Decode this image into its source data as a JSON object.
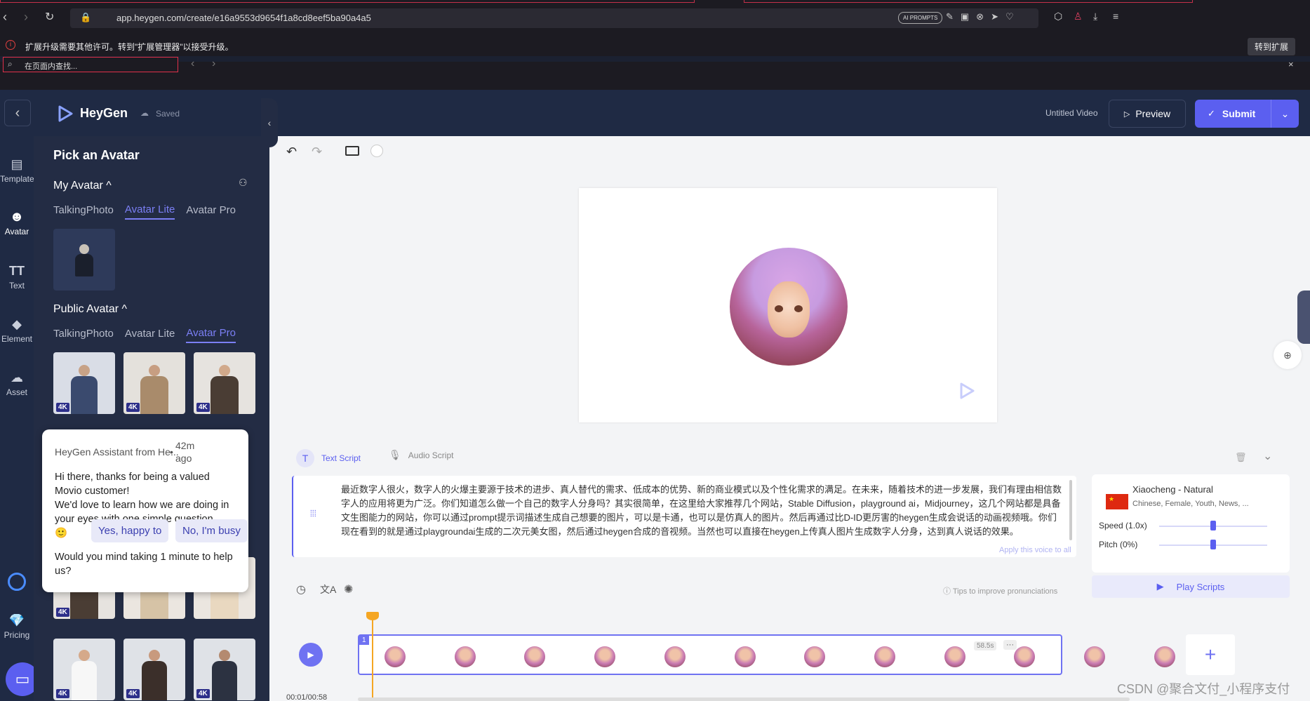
{
  "browser": {
    "url": "app.heygen.com/create/e16a9553d9654f1a8cd8eef5ba90a4a5",
    "ai_prompts": "AI PROMPTS",
    "ext_notice": "扩展升级需要其他许可。转到\"扩展管理器\"以接受升级。",
    "ext_button": "转到扩展",
    "find_placeholder": "在页面内查找...",
    "close": "×"
  },
  "header": {
    "brand": "HeyGen",
    "saved": "Saved",
    "video_title": "Untitled Video",
    "preview": "Preview",
    "submit": "Submit"
  },
  "sidebar": {
    "items": [
      {
        "label": "Template",
        "icon": "template-icon"
      },
      {
        "label": "Avatar",
        "icon": "avatar-icon"
      },
      {
        "label": "Text",
        "icon": "text-icon"
      },
      {
        "label": "Element",
        "icon": "element-icon"
      },
      {
        "label": "Asset",
        "icon": "asset-icon"
      },
      {
        "label": "Pricing",
        "icon": "pricing-icon"
      }
    ]
  },
  "panel": {
    "title": "Pick an Avatar",
    "my_avatar": "My Avatar",
    "public_avatar": "Public Avatar",
    "my_tabs": [
      "TalkingPhoto",
      "Avatar Lite",
      "Avatar Pro"
    ],
    "public_tabs": [
      "TalkingPhoto",
      "Avatar Lite",
      "Avatar Pro"
    ],
    "badge": "4K"
  },
  "chat": {
    "sender": "HeyGen Assistant from He...",
    "time": "42m ago",
    "sep": "•",
    "line1": "Hi there, thanks for being a valued Movio customer!",
    "line2": "We'd love to learn how we are doing in your eyes with one simple question",
    "emoji": "🙂",
    "line3": "Would you mind taking 1 minute to help us?",
    "yes": "Yes, happy to",
    "no": "No, I'm busy"
  },
  "script": {
    "tab_text": "Text Script",
    "tab_audio": "Audio Script",
    "body": "最近数字人很火，数字人的火爆主要源于技术的进步、真人替代的需求、低成本的优势、新的商业模式以及个性化需求的满足。在未来，随着技术的进一步发展，我们有理由相信数字人的应用将更为广泛。你们知道怎么做一个自己的数字人分身吗？其实很简单，在这里给大家推荐几个网站，Stable Diffusion，playground ai，Midjourney，这几个网站都是具备文生图能力的网站，你可以通过prompt提示词描述生成自己想要的图片，可以是卡通，也可以是仿真人的图片。然后再通过比D-ID更厉害的heygen生成会说话的动画视频哦。你们现在看到的就是通过playgroundai生成的二次元美女图，然后通过heygen合成的音视频。当然也可以直接在heygen上传真人图片生成数字人分身，达到真人说话的效果。",
    "apply_all": "Apply this voice to all",
    "tips": "Tips to improve pronunciations"
  },
  "voice": {
    "name": "Xiaocheng - Natural",
    "desc": "Chinese, Female, Youth, News, ...",
    "speed": "Speed (1.0x)",
    "pitch": "Pitch (0%)",
    "speed_value": 0.5,
    "pitch_value": 0.5,
    "play": "Play Scripts"
  },
  "timeline": {
    "time": "00:01/00:58",
    "scene_num": "1",
    "duration": "58.5s",
    "more": "···"
  },
  "watermark": "CSDN @聚合文付_小程序支付",
  "colors": {
    "accent": "#5b5ff0",
    "header": "#1f2a44",
    "panel": "#232c44"
  }
}
